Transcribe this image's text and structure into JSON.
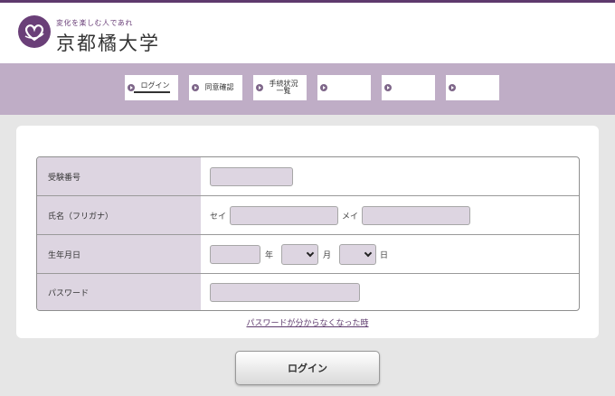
{
  "header": {
    "tagline": "変化を楽しむ人であれ",
    "university_name": "京都橘大学",
    "brand_color": "#6a3f78"
  },
  "steps": [
    {
      "label": "ログイン",
      "active": true
    },
    {
      "label": "同意確認",
      "active": false
    },
    {
      "label": "手続状況一覧",
      "active": false
    },
    {
      "label": "",
      "active": false
    },
    {
      "label": "",
      "active": false
    },
    {
      "label": "",
      "active": false
    }
  ],
  "form": {
    "exam_number": {
      "label": "受験番号",
      "value": ""
    },
    "name_kana": {
      "label": "氏名（フリガナ）",
      "sei_label": "セイ",
      "mei_label": "メイ",
      "sei_value": "",
      "mei_value": ""
    },
    "birthdate": {
      "label": "生年月日",
      "year_value": "",
      "year_unit": "年",
      "month_value": "",
      "month_unit": "月",
      "day_value": "",
      "day_unit": "日"
    },
    "password": {
      "label": "パスワード",
      "value": ""
    }
  },
  "forgot_password_link": "パスワードが分からなくなった時",
  "login_button": "ログイン"
}
